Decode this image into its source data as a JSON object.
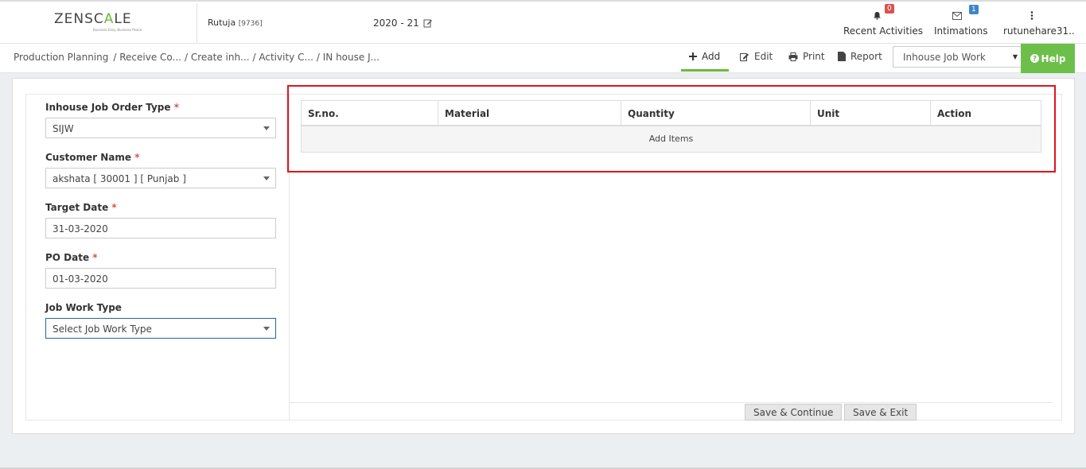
{
  "header": {
    "logo_main": "ZENSC",
    "logo_accent": "A",
    "logo_end": "LE",
    "logo_tagline": "Business Easy. Business Peace.",
    "user_name": "Rutuja",
    "user_id": "[9736]",
    "financial_year": "2020 - 21",
    "recent_activities_label": "Recent Activities",
    "recent_activities_count": "0",
    "intimations_label": "Intimations",
    "intimations_count": "1",
    "username": "rutunehare31.."
  },
  "breadcrumb": {
    "items": [
      "Production Planning",
      "/ Receive Co...",
      "/ Create inh...",
      "/ Activity C...",
      "/ IN house J..."
    ]
  },
  "toolbar": {
    "add_label": "Add",
    "edit_label": "Edit",
    "print_label": "Print",
    "report_label": "Report",
    "module_select_value": "Inhouse Job Work",
    "help_label": "Help"
  },
  "form": {
    "order_type_label": "Inhouse Job Order Type",
    "order_type_value": "SIJW",
    "customer_label": "Customer Name",
    "customer_value": "akshata [ 30001 ] [ Punjab ]",
    "target_date_label": "Target Date",
    "target_date_value": "31-03-2020",
    "po_date_label": "PO Date",
    "po_date_value": "01-03-2020",
    "job_work_type_label": "Job Work Type",
    "job_work_type_value": "Select Job Work Type",
    "required_mark": "*"
  },
  "table": {
    "columns": [
      "Sr.no.",
      "Material",
      "Quantity",
      "Unit",
      "Action"
    ],
    "add_items_label": "Add Items"
  },
  "actions": {
    "save_continue_label": "Save & Continue",
    "save_exit_label": "Save & Exit"
  },
  "colors": {
    "accent_green": "#6cc04a",
    "highlight_red": "#e0141e",
    "badge_red": "#d9534f",
    "badge_blue": "#3a87c8"
  }
}
